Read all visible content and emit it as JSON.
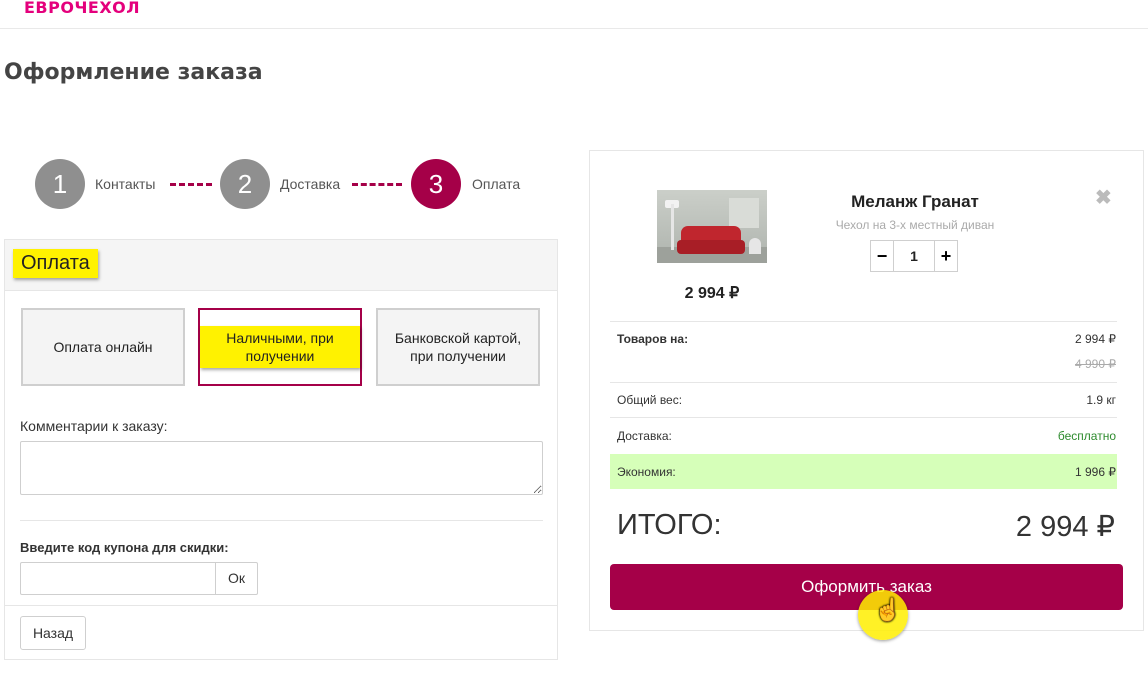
{
  "brand": {
    "logo_text": "ЕВРОЧЕХОЛ",
    "color": "#e4007c"
  },
  "page": {
    "title": "Оформление заказа"
  },
  "steps": [
    {
      "number": "1",
      "label": "Контакты",
      "state": "done"
    },
    {
      "number": "2",
      "label": "Доставка",
      "state": "done"
    },
    {
      "number": "3",
      "label": "Оплата",
      "state": "active"
    }
  ],
  "payment": {
    "title": "Оплата",
    "options": [
      {
        "label": "Оплата онлайн",
        "selected": false
      },
      {
        "label": "Наличными, при получении",
        "selected": true
      },
      {
        "label": "Банковской картой, при получении",
        "selected": false
      }
    ],
    "comment_label": "Комментарии к заказу:",
    "comment_value": "",
    "coupon_label": "Введите код купона для скидки:",
    "coupon_value": "",
    "coupon_button": "Ок",
    "back_button": "Назад"
  },
  "cart": {
    "product": {
      "name": "Меланж Гранат",
      "subtitle": "Чехол на 3-х местный диван",
      "price": "2 994 ₽",
      "quantity": "1",
      "image_icon": "red-sofa-photo"
    },
    "summary": {
      "goods_label": "Товаров на:",
      "goods_value": "2 994 ₽",
      "goods_old_value": "4 990 ₽",
      "weight_label": "Общий вес:",
      "weight_value": "1.9 кг",
      "delivery_label": "Доставка:",
      "delivery_value": "бесплатно",
      "savings_label": "Экономия:",
      "savings_value": "1 996 ₽",
      "total_label": "ИТОГО:",
      "total_value": "2 994 ₽"
    },
    "order_button": "Оформить заказ"
  },
  "colors": {
    "accent": "#a50048",
    "highlight": "#fff200",
    "savings_bg": "#d6ffb9",
    "free_delivery": "#2e8b2e"
  }
}
